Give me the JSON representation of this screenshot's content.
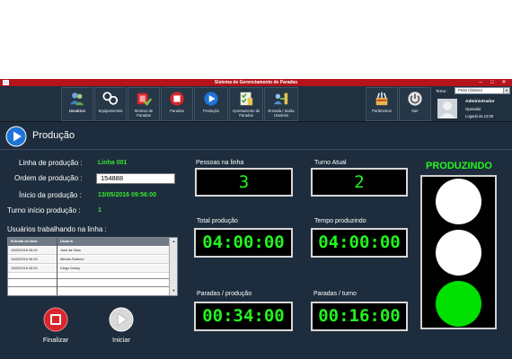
{
  "window": {
    "title": "Sistema de Gerenciamento de Paradas",
    "minimize": "–",
    "maximize": "□",
    "close": "✕"
  },
  "ribbon": {
    "items": [
      {
        "label": "Usuários",
        "icon": "users-icon"
      },
      {
        "label": "Equipamentos",
        "icon": "gears-icon"
      },
      {
        "label": "Motivos de Paradas",
        "icon": "stop-reasons-icon"
      },
      {
        "label": "Paradas",
        "icon": "stop-icon"
      },
      {
        "label": "Produção",
        "icon": "play-icon"
      },
      {
        "label": "Apontamento de Paradas",
        "icon": "checklist-icon"
      },
      {
        "label": "Entrada / Saída Usuários",
        "icon": "user-entry-exit-icon"
      },
      {
        "label": "Parâmetros",
        "icon": "parameters-icon"
      },
      {
        "label": "Sair",
        "icon": "power-icon"
      }
    ],
    "theme_label": "Tema :",
    "theme_value": "Preto Clássico",
    "theme_dropdown": "▾",
    "user": {
      "name": "Administrador",
      "role": "Operador",
      "login": "Logado às 12:00"
    }
  },
  "page": {
    "title": "Produção"
  },
  "info": {
    "linha_label": "Linha de produção :",
    "linha_value": "Linha 001",
    "ordem_label": "Ordem de produção :",
    "ordem_value": "154888",
    "inicio_label": "Ínicio da produção :",
    "inicio_value": "13/05/2016 09:56:00",
    "turno_label": "Turno início produção :",
    "turno_value": "1"
  },
  "users_table": {
    "title": "Usuários trabalhando na linha :",
    "columns": [
      "Entrada na linha",
      "Usuário"
    ],
    "rows": [
      [
        "13/05/2016 06:00",
        "José da Silva"
      ],
      [
        "13/05/2016 06:33",
        "Alfredo Roberto"
      ],
      [
        "13/05/2016 06:54",
        "Diego Godoy"
      ]
    ],
    "scroll_up": "▲",
    "scroll_down": "▼"
  },
  "actions": {
    "finalizar": "Finalizar",
    "iniciar": "Iniciar"
  },
  "counters": {
    "pessoas_label": "Pessoas na linha",
    "pessoas_value": "3",
    "turno_atual_label": "Turno Atual",
    "turno_atual_value": "2",
    "total_producao_label": "Total produção",
    "total_producao_value": "04:00:00",
    "tempo_produzindo_label": "Tempo produzindo",
    "tempo_produzindo_value": "04:00:00",
    "paradas_producao_label": "Paradas / produção",
    "paradas_producao_value": "00:34:00",
    "paradas_turno_label": "Paradas / turno",
    "paradas_turno_value": "00:16:00"
  },
  "status": {
    "label": "PRODUZINDO",
    "lamps": [
      "off",
      "off",
      "on"
    ],
    "on_color": "#00e000",
    "off_color": "#ffffff"
  },
  "colors": {
    "titlebar": "#b5141c",
    "background": "#1e2d3d",
    "accent_green": "#22f51e"
  }
}
